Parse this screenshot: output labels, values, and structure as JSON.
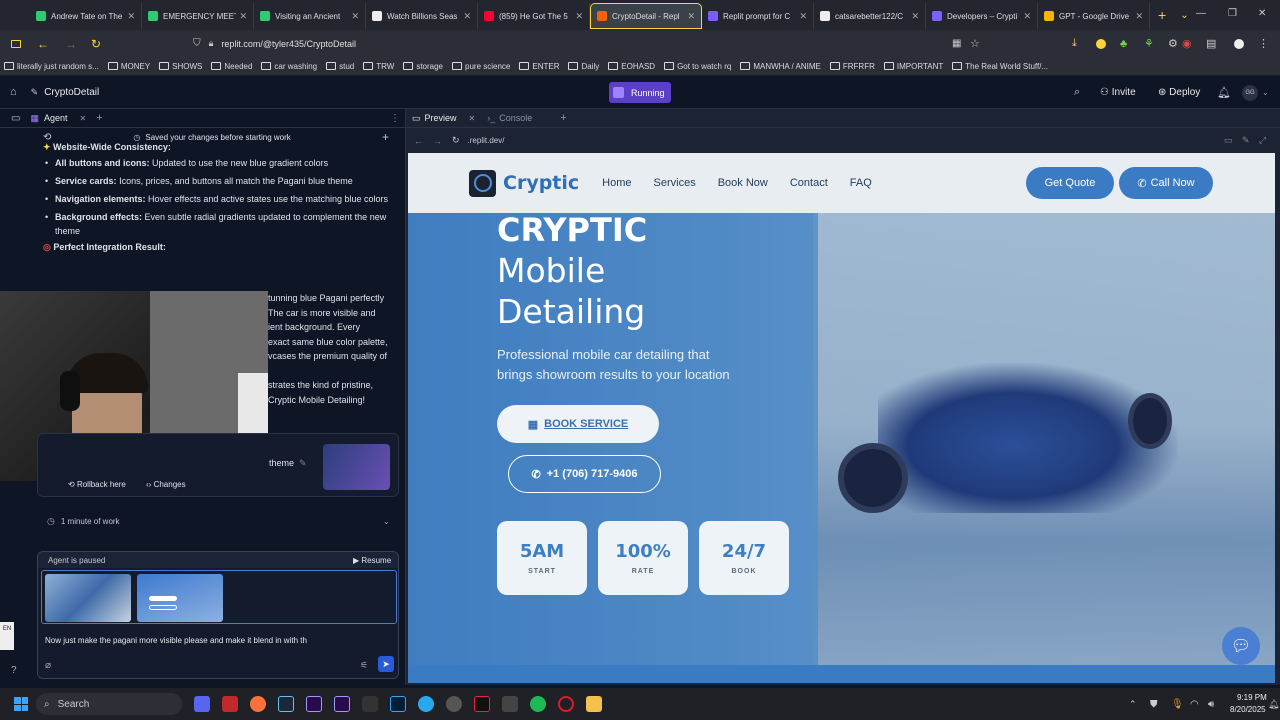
{
  "tabs": [
    {
      "title": "Andrew Tate on The",
      "color": "#2ecc71"
    },
    {
      "title": "EMERGENCY MEETI",
      "color": "#2ecc71"
    },
    {
      "title": "Visiting an Ancient",
      "color": "#2ecc71"
    },
    {
      "title": "Watch Billions Seas",
      "color": "#eeeeee"
    },
    {
      "title": "(859) He Got The 5",
      "color": "#ff0033"
    },
    {
      "title": "CryptoDetail - Repl",
      "color": "#f26207"
    },
    {
      "title": "Replit prompt for C",
      "color": "#7c5cff"
    },
    {
      "title": "catsarebetter122/C",
      "color": "#eeeeee"
    },
    {
      "title": "Developers – Crypti",
      "color": "#7b61ff"
    },
    {
      "title": "GPT - Google Drive",
      "color": "#f4b400"
    }
  ],
  "browser": {
    "url": "replit.com/@tyler435/CryptoDetail"
  },
  "bookmarks": [
    "literally just random s...",
    "MONEY",
    "SHOWS",
    "Needed",
    "car washing",
    "stud",
    "TRW",
    "storage",
    "pure science",
    "ENTER",
    "Daily",
    "EOHASD",
    "Got to watch rq",
    "MANWHA / ANIME",
    "FRFRFR",
    "IMPORTANT",
    "The Real World Stuff/..."
  ],
  "app": {
    "project_name": "CryptoDetail",
    "status": "Running",
    "invite": "Invite",
    "deploy": "Deploy",
    "avatar": "GG"
  },
  "agent": {
    "tab_label": "Agent",
    "saved_notice": "Saved your changes before starting work",
    "section_heading": "Website-Wide Consistency:",
    "bullets": [
      {
        "bold": "All buttons and icons:",
        "text": "Updated to use the new blue gradient colors"
      },
      {
        "bold": "Service cards:",
        "text": "Icons, prices, and buttons all match the Pagani blue theme"
      },
      {
        "bold": "Navigation elements:",
        "text": "Hover effects and active states use the matching blue colors"
      },
      {
        "bold": "Background effects:",
        "text": "Even subtle radial gradients updated to complement the new theme"
      }
    ],
    "result_heading": "Perfect Integration Result:",
    "result_lines": [
      "tunning blue Pagani perfectly",
      "The car is more visible and",
      "ient background. Every",
      "exact same blue color palette,",
      "vcases the premium quality of",
      "",
      "strates the kind of pristine,",
      "Cryptic Mobile Detailing!"
    ],
    "theme_word": "theme",
    "rollback": "Rollback here",
    "changes": "Changes",
    "work_time": "1 minute of work",
    "paused": "Agent is paused",
    "resume": "Resume",
    "input_text": "Now just make the pagani more visible please and make it blend in with th",
    "lang": "EN"
  },
  "preview": {
    "tab_preview": "Preview",
    "tab_console": "Console",
    "url": ".replit.dev/"
  },
  "site": {
    "brand": "Cryptic",
    "nav": [
      "Home",
      "Services",
      "Book Now",
      "Contact",
      "FAQ"
    ],
    "quote_btn": "Get Quote",
    "call_btn": "Call Now",
    "hero_line1": "CRYPTIC",
    "hero_line2": "Mobile",
    "hero_line3": "Detailing",
    "hero_sub1": "Professional mobile car detailing that",
    "hero_sub2": "brings showroom results to your location",
    "book_btn": "BOOK SERVICE",
    "phone_btn": "+1 (706) 717-9406",
    "stats": [
      {
        "value": "5AM",
        "label": "START"
      },
      {
        "value": "100%",
        "label": "RATE"
      },
      {
        "value": "24/7",
        "label": "BOOK"
      }
    ]
  },
  "taskbar": {
    "search": "Search",
    "time": "9:19 PM",
    "date": "8/20/2025"
  }
}
